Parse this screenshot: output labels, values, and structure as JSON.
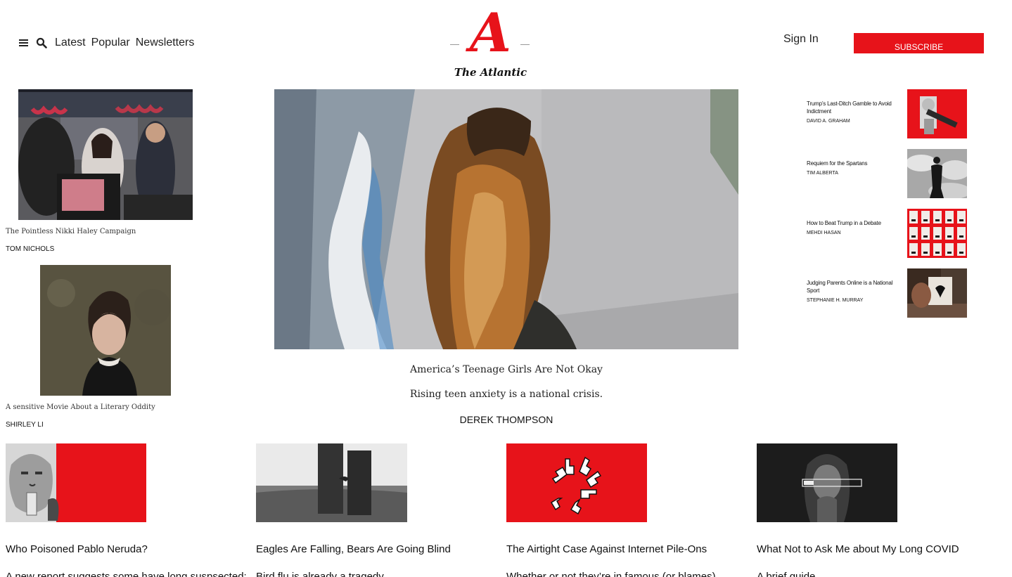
{
  "header": {
    "menu_icon": "hamburger-menu-icon",
    "search_icon": "search-icon",
    "nav": [
      "Latest",
      "Popular",
      "Newsletters"
    ],
    "logo_wordmark": "The Atlantic",
    "sign_in": "Sign In",
    "subscribe": "SUBSCRIBE"
  },
  "colors": {
    "brand_red": "#e7131a"
  },
  "left_stories": [
    {
      "title": "The Pointless Nikki Haley Campaign",
      "author": "TOM NICHOLS"
    },
    {
      "title": "A sensitive Movie About a Literary Oddity",
      "author": "SHIRLEY LI"
    }
  ],
  "hero": {
    "title": "America’s Teenage Girls Are Not Okay",
    "dek": "Rising teen anxiety is a national crisis.",
    "author": "DEREK THOMPSON"
  },
  "rail": [
    {
      "title": "Trump’s Last-Ditch Gamble to Avoid Indictment",
      "author": "DAVID A. GRAHAM"
    },
    {
      "title": "Requiem for the Spartans",
      "author": "TIM ALBERTA"
    },
    {
      "title": "How to Beat Trump in a Debate",
      "author": "MEHDI HASAN"
    },
    {
      "title": "Judging Parents Online is a National Sport",
      "author": "STEPHANIE H. MURRAY"
    }
  ],
  "bottom": [
    {
      "title": "Who Poisoned Pablo Neruda?",
      "dek": "A new report suggests some have long suspsected:"
    },
    {
      "title": "Eagles Are Falling, Bears Are Going Blind",
      "dek": "Bird flu is already a tragedy."
    },
    {
      "title": "The Airtight Case Against Internet Pile-Ons",
      "dek": "Whether or not they’re in famous (or blames),"
    },
    {
      "title": "What Not to Ask Me about My Long COVID",
      "dek": "A brief guide"
    }
  ]
}
